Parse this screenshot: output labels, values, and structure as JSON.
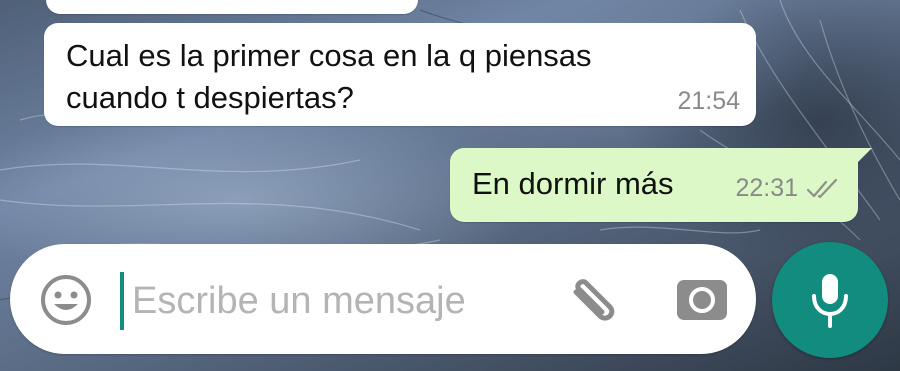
{
  "chat": {
    "incoming_message": {
      "text_line1": "Cual es la primer cosa en la q piensas",
      "text_line2": "cuando t despiertas?",
      "time": "21:54"
    },
    "outgoing_message": {
      "text": "En dormir más",
      "time": "22:31",
      "status_icon": "double-check-icon"
    }
  },
  "composer": {
    "placeholder": "Escribe un mensaje",
    "value": "",
    "icons": {
      "emoji": "emoji-icon",
      "attach": "paperclip-icon",
      "camera": "camera-icon",
      "send": "microphone-icon"
    }
  },
  "colors": {
    "accent": "#128c7e",
    "outgoing_bubble": "#dcf8c6",
    "incoming_bubble": "#ffffff",
    "timestamp": "#8a8a8a",
    "placeholder": "#b4b4b4"
  }
}
